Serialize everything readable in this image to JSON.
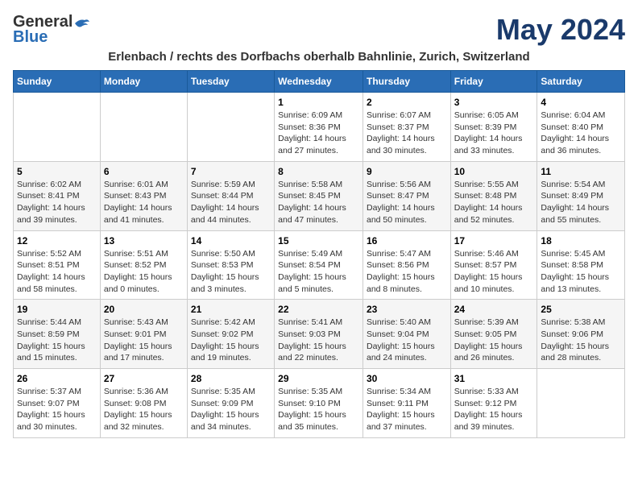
{
  "header": {
    "logo_general": "General",
    "logo_blue": "Blue",
    "month_title": "May 2024",
    "subtitle": "Erlenbach / rechts des Dorfbachs oberhalb Bahnlinie, Zurich, Switzerland"
  },
  "days_of_week": [
    "Sunday",
    "Monday",
    "Tuesday",
    "Wednesday",
    "Thursday",
    "Friday",
    "Saturday"
  ],
  "weeks": [
    [
      {
        "day": "",
        "info": ""
      },
      {
        "day": "",
        "info": ""
      },
      {
        "day": "",
        "info": ""
      },
      {
        "day": "1",
        "info": "Sunrise: 6:09 AM\nSunset: 8:36 PM\nDaylight: 14 hours\nand 27 minutes."
      },
      {
        "day": "2",
        "info": "Sunrise: 6:07 AM\nSunset: 8:37 PM\nDaylight: 14 hours\nand 30 minutes."
      },
      {
        "day": "3",
        "info": "Sunrise: 6:05 AM\nSunset: 8:39 PM\nDaylight: 14 hours\nand 33 minutes."
      },
      {
        "day": "4",
        "info": "Sunrise: 6:04 AM\nSunset: 8:40 PM\nDaylight: 14 hours\nand 36 minutes."
      }
    ],
    [
      {
        "day": "5",
        "info": "Sunrise: 6:02 AM\nSunset: 8:41 PM\nDaylight: 14 hours\nand 39 minutes."
      },
      {
        "day": "6",
        "info": "Sunrise: 6:01 AM\nSunset: 8:43 PM\nDaylight: 14 hours\nand 41 minutes."
      },
      {
        "day": "7",
        "info": "Sunrise: 5:59 AM\nSunset: 8:44 PM\nDaylight: 14 hours\nand 44 minutes."
      },
      {
        "day": "8",
        "info": "Sunrise: 5:58 AM\nSunset: 8:45 PM\nDaylight: 14 hours\nand 47 minutes."
      },
      {
        "day": "9",
        "info": "Sunrise: 5:56 AM\nSunset: 8:47 PM\nDaylight: 14 hours\nand 50 minutes."
      },
      {
        "day": "10",
        "info": "Sunrise: 5:55 AM\nSunset: 8:48 PM\nDaylight: 14 hours\nand 52 minutes."
      },
      {
        "day": "11",
        "info": "Sunrise: 5:54 AM\nSunset: 8:49 PM\nDaylight: 14 hours\nand 55 minutes."
      }
    ],
    [
      {
        "day": "12",
        "info": "Sunrise: 5:52 AM\nSunset: 8:51 PM\nDaylight: 14 hours\nand 58 minutes."
      },
      {
        "day": "13",
        "info": "Sunrise: 5:51 AM\nSunset: 8:52 PM\nDaylight: 15 hours\nand 0 minutes."
      },
      {
        "day": "14",
        "info": "Sunrise: 5:50 AM\nSunset: 8:53 PM\nDaylight: 15 hours\nand 3 minutes."
      },
      {
        "day": "15",
        "info": "Sunrise: 5:49 AM\nSunset: 8:54 PM\nDaylight: 15 hours\nand 5 minutes."
      },
      {
        "day": "16",
        "info": "Sunrise: 5:47 AM\nSunset: 8:56 PM\nDaylight: 15 hours\nand 8 minutes."
      },
      {
        "day": "17",
        "info": "Sunrise: 5:46 AM\nSunset: 8:57 PM\nDaylight: 15 hours\nand 10 minutes."
      },
      {
        "day": "18",
        "info": "Sunrise: 5:45 AM\nSunset: 8:58 PM\nDaylight: 15 hours\nand 13 minutes."
      }
    ],
    [
      {
        "day": "19",
        "info": "Sunrise: 5:44 AM\nSunset: 8:59 PM\nDaylight: 15 hours\nand 15 minutes."
      },
      {
        "day": "20",
        "info": "Sunrise: 5:43 AM\nSunset: 9:01 PM\nDaylight: 15 hours\nand 17 minutes."
      },
      {
        "day": "21",
        "info": "Sunrise: 5:42 AM\nSunset: 9:02 PM\nDaylight: 15 hours\nand 19 minutes."
      },
      {
        "day": "22",
        "info": "Sunrise: 5:41 AM\nSunset: 9:03 PM\nDaylight: 15 hours\nand 22 minutes."
      },
      {
        "day": "23",
        "info": "Sunrise: 5:40 AM\nSunset: 9:04 PM\nDaylight: 15 hours\nand 24 minutes."
      },
      {
        "day": "24",
        "info": "Sunrise: 5:39 AM\nSunset: 9:05 PM\nDaylight: 15 hours\nand 26 minutes."
      },
      {
        "day": "25",
        "info": "Sunrise: 5:38 AM\nSunset: 9:06 PM\nDaylight: 15 hours\nand 28 minutes."
      }
    ],
    [
      {
        "day": "26",
        "info": "Sunrise: 5:37 AM\nSunset: 9:07 PM\nDaylight: 15 hours\nand 30 minutes."
      },
      {
        "day": "27",
        "info": "Sunrise: 5:36 AM\nSunset: 9:08 PM\nDaylight: 15 hours\nand 32 minutes."
      },
      {
        "day": "28",
        "info": "Sunrise: 5:35 AM\nSunset: 9:09 PM\nDaylight: 15 hours\nand 34 minutes."
      },
      {
        "day": "29",
        "info": "Sunrise: 5:35 AM\nSunset: 9:10 PM\nDaylight: 15 hours\nand 35 minutes."
      },
      {
        "day": "30",
        "info": "Sunrise: 5:34 AM\nSunset: 9:11 PM\nDaylight: 15 hours\nand 37 minutes."
      },
      {
        "day": "31",
        "info": "Sunrise: 5:33 AM\nSunset: 9:12 PM\nDaylight: 15 hours\nand 39 minutes."
      },
      {
        "day": "",
        "info": ""
      }
    ]
  ]
}
